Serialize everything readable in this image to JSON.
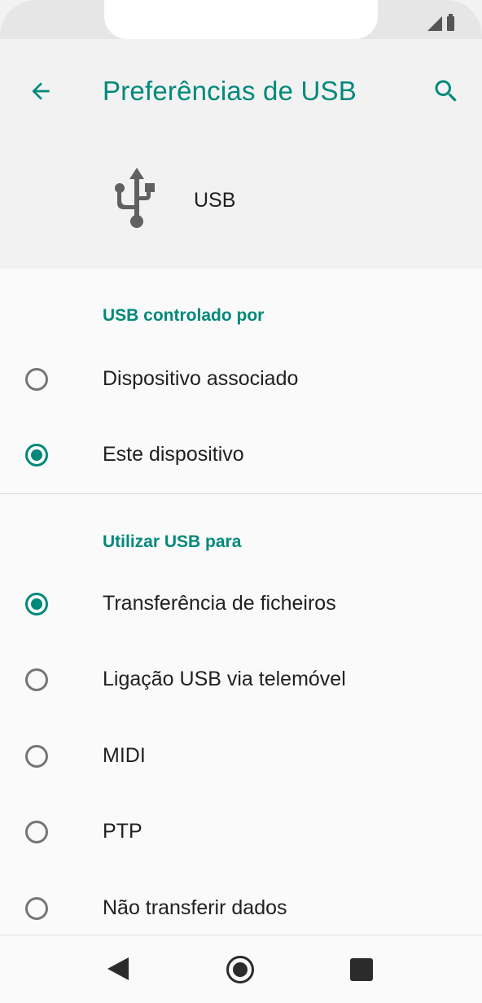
{
  "status_bar": {
    "icons": [
      "signal-icon",
      "battery-icon"
    ]
  },
  "app_bar": {
    "title": "Preferências de USB",
    "back_icon": "arrow-back-icon",
    "search_icon": "search-icon"
  },
  "usb_header": {
    "icon": "usb-icon",
    "label": "USB"
  },
  "sections": [
    {
      "title": "USB controlado por",
      "options": [
        {
          "label": "Dispositivo associado",
          "checked": false
        },
        {
          "label": "Este dispositivo",
          "checked": true
        }
      ]
    },
    {
      "title": "Utilizar USB para",
      "options": [
        {
          "label": "Transferência de ficheiros",
          "checked": true
        },
        {
          "label": "Ligação USB via telemóvel",
          "checked": false
        },
        {
          "label": "MIDI",
          "checked": false
        },
        {
          "label": "PTP",
          "checked": false
        },
        {
          "label": "Não transferir dados",
          "checked": false
        }
      ]
    }
  ],
  "nav_bar": {
    "icons": [
      "nav-back-icon",
      "nav-home-icon",
      "nav-recents-icon"
    ]
  },
  "colors": {
    "accent": "#00897b",
    "text": "#212121",
    "radio_unchecked": "#757575",
    "header_bg": "#f2f2f2",
    "page_bg": "#fafafa"
  }
}
